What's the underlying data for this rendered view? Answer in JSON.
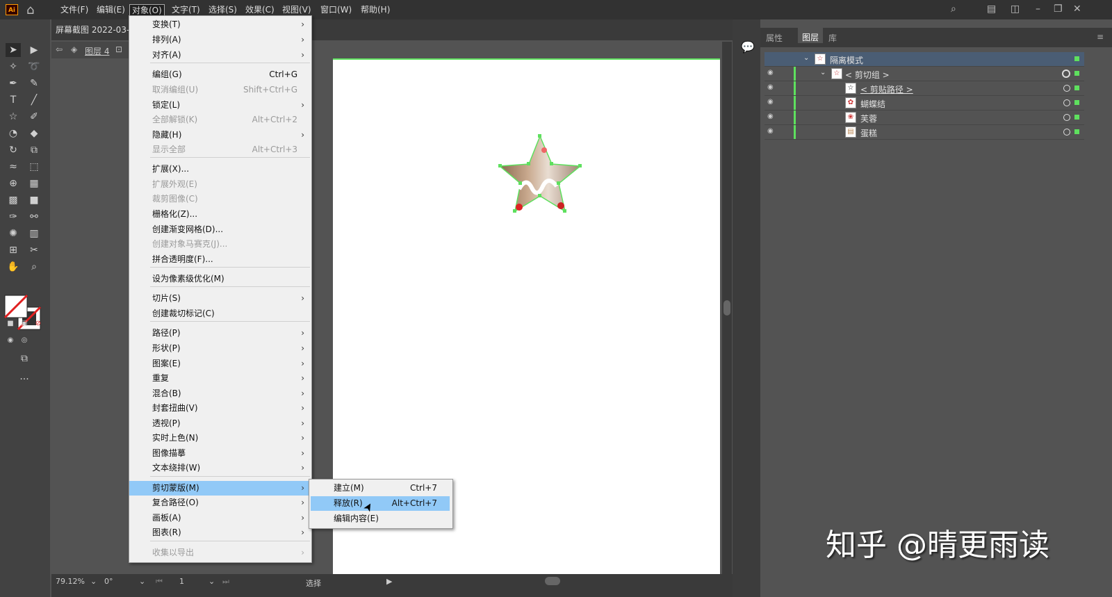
{
  "menubar": {
    "logo": "Ai",
    "items": [
      "文件(F)",
      "编辑(E)",
      "对象(O)",
      "文字(T)",
      "选择(S)",
      "效果(C)",
      "视图(V)",
      "窗口(W)",
      "帮助(H)"
    ]
  },
  "document": {
    "tab_title": "屏幕截图  2022-03-",
    "layer_label": "图层 4"
  },
  "object_menu": [
    {
      "label": "变换(T)",
      "shortcut": "",
      "submenu": true,
      "disabled": false
    },
    {
      "label": "排列(A)",
      "shortcut": "",
      "submenu": true,
      "disabled": false
    },
    {
      "label": "对齐(A)",
      "shortcut": "",
      "submenu": true,
      "disabled": false
    },
    {
      "label": "编组(G)",
      "shortcut": "Ctrl+G",
      "submenu": false,
      "disabled": false
    },
    {
      "label": "取消编组(U)",
      "shortcut": "Shift+Ctrl+G",
      "submenu": false,
      "disabled": true
    },
    {
      "label": "锁定(L)",
      "shortcut": "",
      "submenu": true,
      "disabled": false
    },
    {
      "label": "全部解锁(K)",
      "shortcut": "Alt+Ctrl+2",
      "submenu": false,
      "disabled": true
    },
    {
      "label": "隐藏(H)",
      "shortcut": "",
      "submenu": true,
      "disabled": false
    },
    {
      "label": "显示全部",
      "shortcut": "Alt+Ctrl+3",
      "submenu": false,
      "disabled": true
    },
    {
      "label": "扩展(X)...",
      "shortcut": "",
      "submenu": false,
      "disabled": false
    },
    {
      "label": "扩展外观(E)",
      "shortcut": "",
      "submenu": false,
      "disabled": true
    },
    {
      "label": "裁剪图像(C)",
      "shortcut": "",
      "submenu": false,
      "disabled": true
    },
    {
      "label": "栅格化(Z)...",
      "shortcut": "",
      "submenu": false,
      "disabled": false
    },
    {
      "label": "创建渐变网格(D)...",
      "shortcut": "",
      "submenu": false,
      "disabled": false
    },
    {
      "label": "创建对象马赛克(J)...",
      "shortcut": "",
      "submenu": false,
      "disabled": true
    },
    {
      "label": "拼合透明度(F)...",
      "shortcut": "",
      "submenu": false,
      "disabled": false
    },
    {
      "label": "设为像素级优化(M)",
      "shortcut": "",
      "submenu": false,
      "disabled": false
    },
    {
      "label": "切片(S)",
      "shortcut": "",
      "submenu": true,
      "disabled": false
    },
    {
      "label": "创建裁切标记(C)",
      "shortcut": "",
      "submenu": false,
      "disabled": false
    },
    {
      "label": "路径(P)",
      "shortcut": "",
      "submenu": true,
      "disabled": false
    },
    {
      "label": "形状(P)",
      "shortcut": "",
      "submenu": true,
      "disabled": false
    },
    {
      "label": "图案(E)",
      "shortcut": "",
      "submenu": true,
      "disabled": false
    },
    {
      "label": "重复",
      "shortcut": "",
      "submenu": true,
      "disabled": false
    },
    {
      "label": "混合(B)",
      "shortcut": "",
      "submenu": true,
      "disabled": false
    },
    {
      "label": "封套扭曲(V)",
      "shortcut": "",
      "submenu": true,
      "disabled": false
    },
    {
      "label": "透视(P)",
      "shortcut": "",
      "submenu": true,
      "disabled": false
    },
    {
      "label": "实时上色(N)",
      "shortcut": "",
      "submenu": true,
      "disabled": false
    },
    {
      "label": "图像描摹",
      "shortcut": "",
      "submenu": true,
      "disabled": false
    },
    {
      "label": "文本绕排(W)",
      "shortcut": "",
      "submenu": true,
      "disabled": false
    },
    {
      "label": "剪切蒙版(M)",
      "shortcut": "",
      "submenu": true,
      "disabled": false,
      "highlighted": true
    },
    {
      "label": "复合路径(O)",
      "shortcut": "",
      "submenu": true,
      "disabled": false
    },
    {
      "label": "画板(A)",
      "shortcut": "",
      "submenu": true,
      "disabled": false
    },
    {
      "label": "图表(R)",
      "shortcut": "",
      "submenu": true,
      "disabled": false
    },
    {
      "label": "收集以导出",
      "shortcut": "",
      "submenu": true,
      "disabled": true
    }
  ],
  "clip_submenu": [
    {
      "label": "建立(M)",
      "shortcut": "Ctrl+7"
    },
    {
      "label": "释放(R)",
      "shortcut": "Alt+Ctrl+7",
      "highlighted": true
    },
    {
      "label": "编辑内容(E)",
      "shortcut": ""
    }
  ],
  "panel": {
    "tabs": [
      "属性",
      "图层",
      "库"
    ],
    "active_tab": "图层",
    "isolation_label": "隔离模式",
    "layers": [
      {
        "name": "< 剪切组 >"
      },
      {
        "name": "< 剪贴路径 >"
      },
      {
        "name": "蝴蝶结"
      },
      {
        "name": "芙蓉"
      },
      {
        "name": "蛋糕"
      }
    ]
  },
  "status": {
    "zoom": "79.12%",
    "rotation": "0°",
    "page": "1",
    "tool": "选择"
  },
  "watermark": "知乎 @晴更雨读",
  "colors": {
    "accent": "#91c9f7",
    "layer_green": "#5ee05e"
  }
}
